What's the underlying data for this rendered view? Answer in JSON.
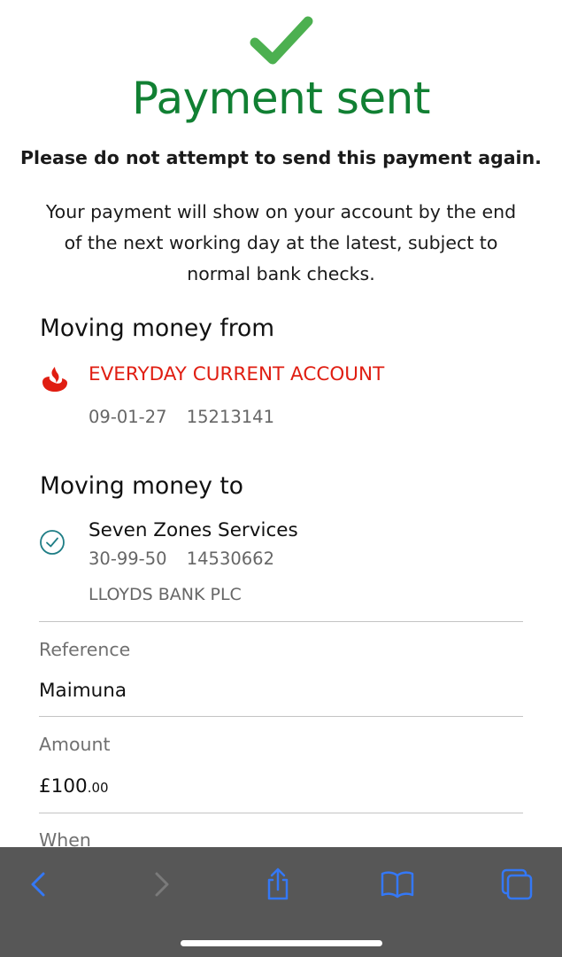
{
  "header": {
    "title": "Payment sent",
    "warning": "Please do not attempt to send this payment again.",
    "info": "Your payment will show on your account by the end of the next working day at the latest, subject to normal bank checks."
  },
  "from": {
    "heading": "Moving money from",
    "account_name": "EVERYDAY CURRENT ACCOUNT",
    "sort_code": "09-01-27",
    "account_number": "15213141",
    "logo_icon": "santander-flame-icon"
  },
  "to": {
    "heading": "Moving money to",
    "payee_name": "Seven Zones Services",
    "sort_code": "30-99-50",
    "account_number": "14530662",
    "bank": "LLOYDS BANK PLC",
    "status_icon": "circle-check-icon"
  },
  "details": {
    "reference_label": "Reference",
    "reference_value": "Maimuna",
    "amount_label": "Amount",
    "amount_pounds": "£100",
    "amount_pence": ".00",
    "when_label": "When"
  },
  "toolbar": {
    "icons": [
      "chevron-left-icon",
      "chevron-right-icon",
      "share-icon",
      "book-icon",
      "tabs-icon"
    ]
  },
  "colors": {
    "success_green": "#118033",
    "check_green": "#4cb050",
    "brand_red": "#e01e12",
    "payee_teal": "#1e7d85",
    "toolbar_bg": "#575757",
    "toolbar_icon_blue": "#3478f6"
  }
}
